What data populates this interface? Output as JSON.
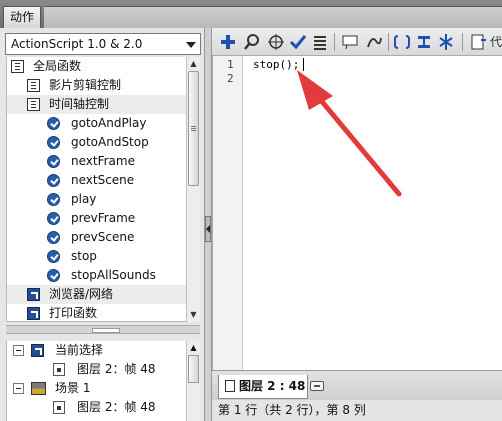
{
  "panel_tab": "动作",
  "version_select": {
    "selected": "ActionScript 1.0 & 2.0",
    "arrow_icon": "chevron-down-icon"
  },
  "tree": {
    "items": [
      {
        "label": "全局函数",
        "icon": "book-icon",
        "level": 0
      },
      {
        "label": "影片剪辑控制",
        "icon": "book-icon",
        "level": 1
      },
      {
        "label": "时间轴控制",
        "icon": "book-icon",
        "level": 1
      },
      {
        "label": "gotoAndPlay",
        "icon": "function-icon",
        "level": 2
      },
      {
        "label": "gotoAndStop",
        "icon": "function-icon",
        "level": 2
      },
      {
        "label": "nextFrame",
        "icon": "function-icon",
        "level": 2
      },
      {
        "label": "nextScene",
        "icon": "function-icon",
        "level": 2
      },
      {
        "label": "play",
        "icon": "function-icon",
        "level": 2
      },
      {
        "label": "prevFrame",
        "icon": "function-icon",
        "level": 2
      },
      {
        "label": "prevScene",
        "icon": "function-icon",
        "level": 2
      },
      {
        "label": "stop",
        "icon": "function-icon",
        "level": 2
      },
      {
        "label": "stopAllSounds",
        "icon": "function-icon",
        "level": 2
      },
      {
        "label": "浏览器/网络",
        "icon": "category-icon",
        "level": 1
      },
      {
        "label": "打印函数",
        "icon": "category-icon",
        "level": 1
      }
    ]
  },
  "script_nav": {
    "items": [
      {
        "label": "当前选择",
        "icon": "selection-icon"
      },
      {
        "label": "图层 2：帧 48",
        "icon": "layer-icon"
      },
      {
        "label": "场景 1",
        "icon": "scene-icon"
      },
      {
        "label": "图层 2：帧 48",
        "icon": "layer-icon"
      }
    ]
  },
  "toolbar": {
    "buttons": [
      "add-icon",
      "find-icon",
      "target-icon",
      "check-syntax-icon",
      "auto-format-icon",
      "code-hint-icon",
      "debug-icon",
      "collapse-icon",
      "collapse-selection-icon",
      "expand-all-icon",
      "script-assist-icon"
    ],
    "truncated_label": "代"
  },
  "editor": {
    "line_numbers": [
      "1",
      "2"
    ],
    "code_lines": [
      "stop();",
      ""
    ],
    "annotation_color": "#e23b3b"
  },
  "bottom_tab": {
    "label": "图层 2 : 48"
  },
  "status_bar": {
    "text": "第 1 行（共 2 行），第 8 列"
  }
}
